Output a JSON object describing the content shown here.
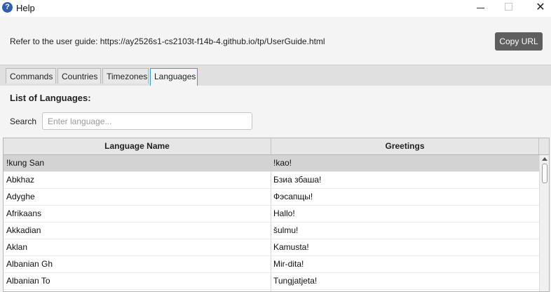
{
  "window": {
    "title": "Help",
    "icon": "help-icon",
    "controls": [
      "minimize-icon",
      "maximize-icon",
      "close-icon"
    ],
    "close_glyph": "✕"
  },
  "header": {
    "url_text": "Refer to the user guide: https://ay2526s1-cs2103t-f14b-4.github.io/tp/UserGuide.html",
    "copy_button": "Copy URL"
  },
  "tabs": [
    {
      "label": "Commands",
      "active": false
    },
    {
      "label": "Countries",
      "active": false
    },
    {
      "label": "Timezones",
      "active": false
    },
    {
      "label": "Languages",
      "active": true
    }
  ],
  "main": {
    "heading": "List of Languages:",
    "search_label": "Search",
    "search_placeholder": "Enter language...",
    "search_value": ""
  },
  "table": {
    "columns": [
      "Language Name",
      "Greetings"
    ],
    "rows": [
      {
        "name": "!kung San",
        "greeting": "!kao!",
        "selected": true
      },
      {
        "name": "Abkhaz",
        "greeting": "Бзиа збаша!",
        "selected": false
      },
      {
        "name": "Adyghe",
        "greeting": "Фэсапщы!",
        "selected": false
      },
      {
        "name": "Afrikaans",
        "greeting": "Hallo!",
        "selected": false
      },
      {
        "name": "Akkadian",
        "greeting": "šulmu!",
        "selected": false
      },
      {
        "name": "Aklan",
        "greeting": "Kamusta!",
        "selected": false
      },
      {
        "name": "Albanian Gh",
        "greeting": "Mir-dita!",
        "selected": false
      },
      {
        "name": "Albanian To",
        "greeting": "Tungjatjeta!",
        "selected": false
      }
    ]
  },
  "colors": {
    "selected_row": "#d3d3d3",
    "active_tab_border": "#3c9fd3",
    "copy_button_bg": "#5f5f5f"
  }
}
